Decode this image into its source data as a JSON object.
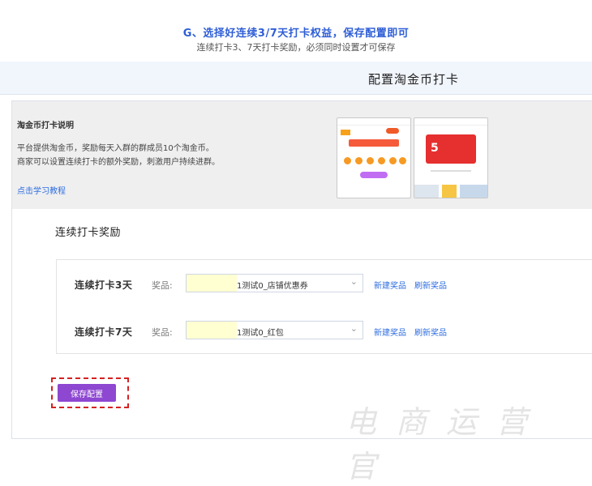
{
  "caption": {
    "title": "G、选择好连续3/7天打卡权益，保存配置即可",
    "subtitle": "连续打卡3、7天打卡奖励，必须同时设置才可保存"
  },
  "header": {
    "title": "配置淘金币打卡"
  },
  "info": {
    "title": "淘金币打卡说明",
    "line1": "平台提供淘金币，奖励每天入群的群成员10个淘金币。",
    "line2": "商家可以设置连续打卡的额外奖励，刺激用户持续进群。",
    "link": "点击学习教程"
  },
  "preview_b": {
    "big_number": "5"
  },
  "section": {
    "title": "连续打卡奖励"
  },
  "rewards": [
    {
      "label": "连续打卡3天",
      "prize_label": "奖品:",
      "value": "1测试0_店铺优惠券",
      "new_link": "新建奖品",
      "refresh_link": "刷新奖品"
    },
    {
      "label": "连续打卡7天",
      "prize_label": "奖品:",
      "value": "1测试0_红包",
      "new_link": "新建奖品",
      "refresh_link": "刷新奖品"
    }
  ],
  "actions": {
    "save_label": "保存配置"
  },
  "watermark": {
    "text": "电商运营官"
  },
  "colors": {
    "accent": "#8e47d1",
    "link": "#2f6ee0",
    "highlight_dash": "#d42222"
  }
}
